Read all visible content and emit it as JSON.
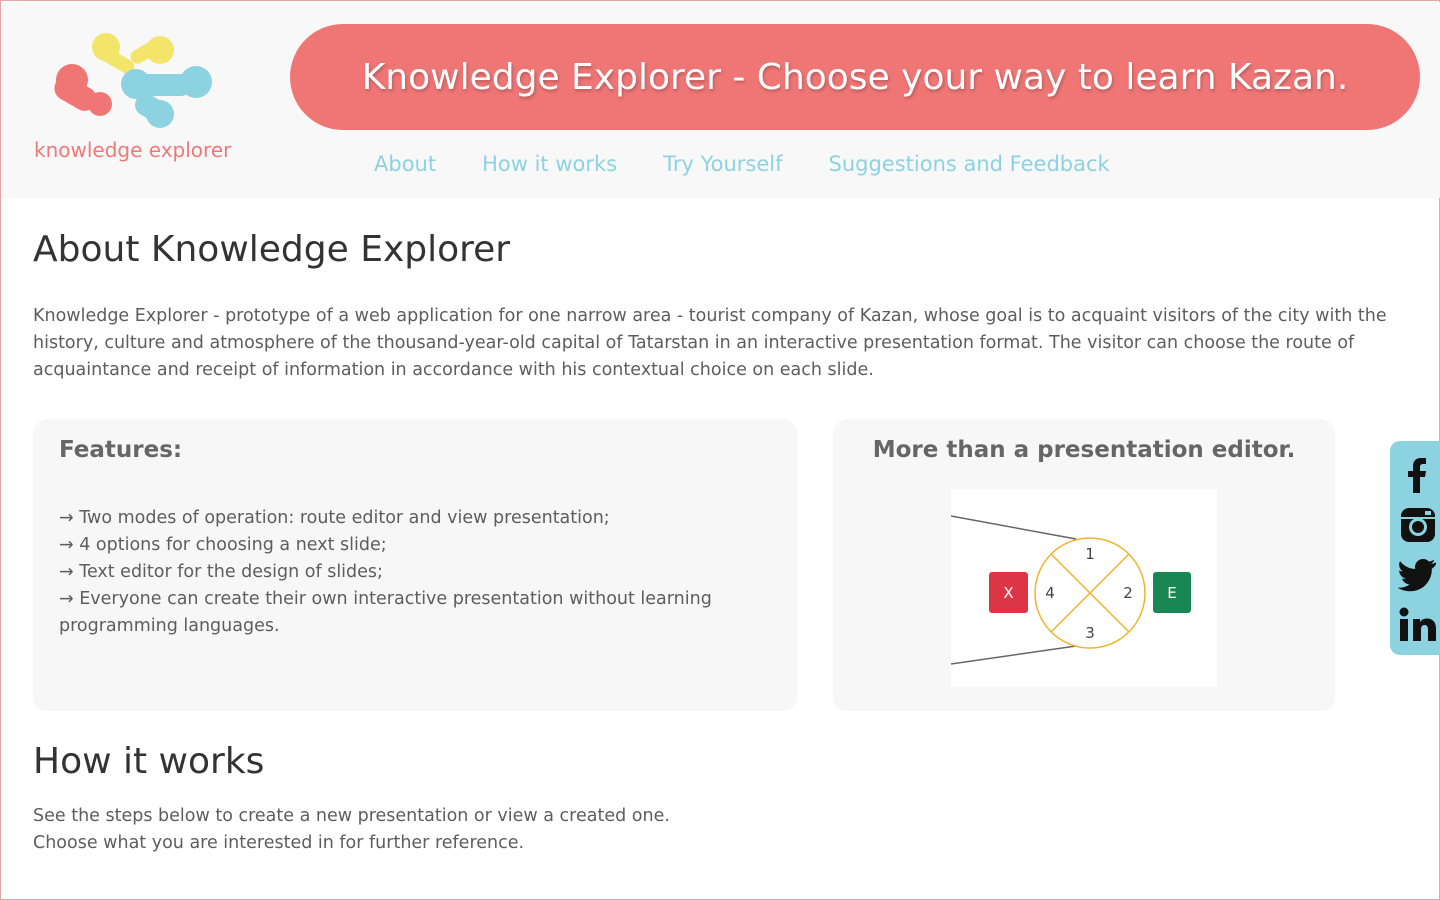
{
  "header": {
    "logo_text": "knowledge explorer",
    "banner_title": "Knowledge Explorer - Choose your way to learn Kazan.",
    "nav": [
      "About",
      "How it works",
      "Try Yourself",
      "Suggestions and Feedback"
    ]
  },
  "about": {
    "title": "About Knowledge Explorer",
    "text": "Knowledge Explorer - prototype of a web application for one narrow area - tourist company of Kazan, whose goal is to acquaint visitors of the city with the history, culture and atmosphere of the thousand-year-old capital of Tatarstan in an interactive presentation format. The visitor can choose the route of acquaintance and receipt of information in accordance with his contextual choice on each slide."
  },
  "features": {
    "title": "Features:",
    "items": [
      "→ Two modes of operation: route editor and view presentation;",
      "→ 4 options for choosing a next slide;",
      "→ Text editor for the design of slides;",
      "→ Everyone can create their own interactive presentation without learning programming languages."
    ]
  },
  "editor_card": {
    "title": "More than a presentation editor.",
    "diagram": {
      "exit_label": "X",
      "enter_label": "E",
      "options": [
        "1",
        "2",
        "3",
        "4"
      ]
    }
  },
  "how": {
    "title": "How it works",
    "line1": "See the steps below to create a new presentation or view a created one.",
    "line2": "Choose what you are interested in for further reference."
  },
  "social": [
    "facebook-icon",
    "instagram-icon",
    "twitter-icon",
    "linkedin-icon"
  ],
  "colors": {
    "accent_red": "#f07676",
    "accent_blue": "#8dd2e0",
    "logo_yellow": "#f3e56a",
    "exit_red": "#dc3545",
    "enter_green": "#198754",
    "ring_orange": "#f0b429"
  }
}
